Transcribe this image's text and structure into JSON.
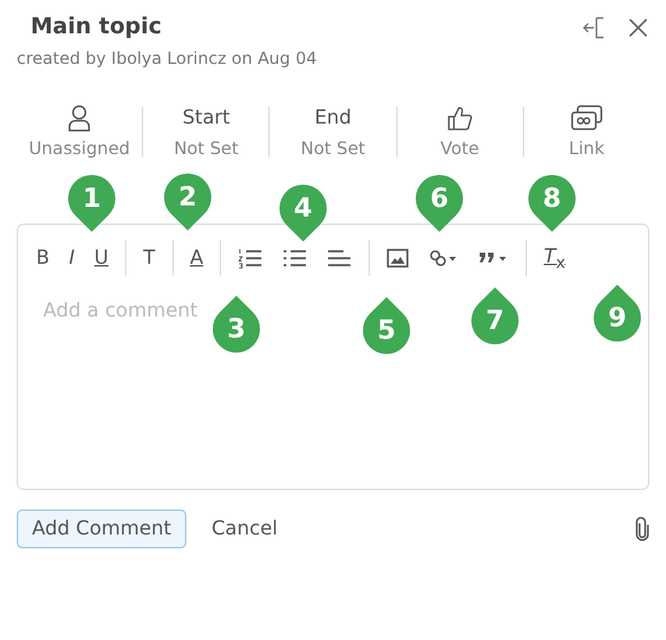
{
  "header": {
    "title": "Main topic",
    "subtitle": "created by Ibolya Lorincz on Aug 04"
  },
  "meta": [
    {
      "kind": "person",
      "label": "Unassigned"
    },
    {
      "kind": "text",
      "value": "Start",
      "label": "Not Set"
    },
    {
      "kind": "text",
      "value": "End",
      "label": "Not Set"
    },
    {
      "kind": "thumb",
      "label": "Vote"
    },
    {
      "kind": "link",
      "label": "Link"
    }
  ],
  "toolbar": [
    [
      {
        "kind": "bold",
        "label": "B"
      },
      {
        "kind": "italic",
        "label": "I"
      },
      {
        "kind": "underline",
        "label": "U"
      }
    ],
    [
      {
        "kind": "plain",
        "label": "T"
      }
    ],
    [
      {
        "kind": "color",
        "label": "A"
      }
    ],
    [
      {
        "kind": "ol"
      },
      {
        "kind": "ul"
      },
      {
        "kind": "align"
      }
    ],
    [
      {
        "kind": "image"
      },
      {
        "kind": "link"
      },
      {
        "kind": "quote"
      }
    ],
    [
      {
        "kind": "clear",
        "label": "*T*$_{x}$"
      }
    ]
  ],
  "editor": {
    "placeholder": "Add a comment"
  },
  "callouts": [
    {
      "number": "1",
      "kind": "down"
    },
    {
      "number": "2",
      "kind": "down"
    },
    {
      "number": "3",
      "kind": "up"
    },
    {
      "number": "4",
      "kind": "down"
    },
    {
      "number": "5",
      "kind": "up"
    },
    {
      "number": "6",
      "kind": "down"
    },
    {
      "number": "7",
      "kind": "up"
    },
    {
      "number": "8",
      "kind": "down"
    },
    {
      "number": "9",
      "kind": "up"
    }
  ],
  "actions": {
    "primary": "Add Comment",
    "secondary": "Cancel"
  }
}
